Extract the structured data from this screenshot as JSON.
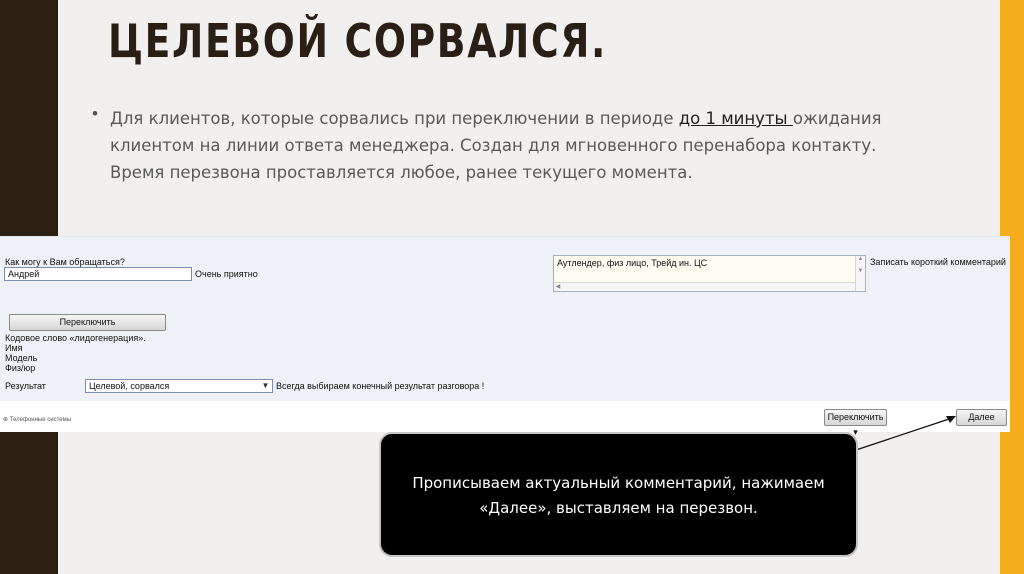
{
  "slide": {
    "title": "ЦЕЛЕВОЙ СОРВАЛСЯ.",
    "bullet_marker": "•",
    "body_part1": "Для клиентов, которые сорвались при переключении в периоде ",
    "body_underlined": "до 1 минуты ",
    "body_part2": "ожидания клиентом на линии ответа менеджера. Создан для мгновенного перенабора контакту. Время перезвона проставляется любое, ранее текущего момента.",
    "colors": {
      "accent": "#f5ad1d",
      "dark": "#2b1f12",
      "background": "#f1f0ef"
    }
  },
  "form": {
    "address_question": "Как могу к Вам обращаться?",
    "name_value": "Андрей",
    "pleasure_text": "Очень приятно",
    "comment_value": "Аутлендер, физ лицо, Трейд ин. ЦС",
    "comment_label": "Записать короткий комментарий",
    "switch_button": "Переключить",
    "code_word": "Кодовое слово «лидогенерация».",
    "name_label": "Имя",
    "model_label": "Модель",
    "person_type_label": "Физ/юр",
    "result_label": "Результат",
    "result_selected": "Целевой, сорвался",
    "result_hint": "Всегда выбираем конечный результат разговора !",
    "footer_logo_text": "Телефонные системы",
    "switch_dropdown_button": "Переключить ▾",
    "next_button": "Далее"
  },
  "callout": {
    "line1": "Прописываем актуальный комментарий, нажимаем",
    "line2": "«Далее», выставляем на перезвон."
  }
}
